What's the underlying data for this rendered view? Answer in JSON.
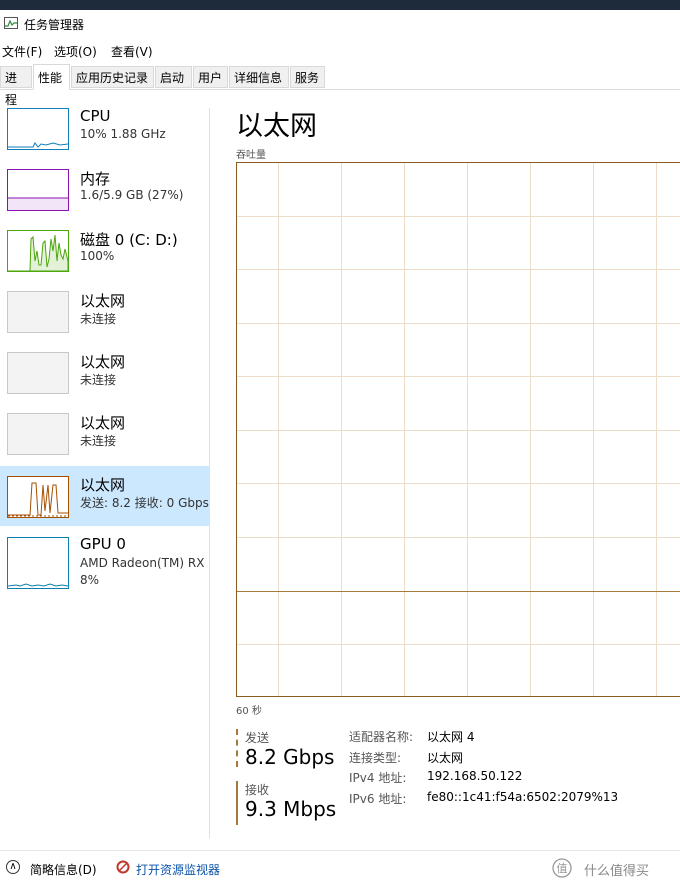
{
  "window": {
    "title": "任务管理器"
  },
  "menu": [
    "文件(F)",
    "选项(O)",
    "查看(V)"
  ],
  "tabs": [
    {
      "label": "进程",
      "active": false
    },
    {
      "label": "性能",
      "active": true
    },
    {
      "label": "应用历史记录",
      "active": false
    },
    {
      "label": "启动",
      "active": false
    },
    {
      "label": "用户",
      "active": false
    },
    {
      "label": "详细信息",
      "active": false
    },
    {
      "label": "服务",
      "active": false
    }
  ],
  "sidebar": [
    {
      "title": "CPU",
      "sub": "10% 1.88 GHz",
      "kind": "cpu"
    },
    {
      "title": "内存",
      "sub": "1.6/5.9 GB (27%)",
      "kind": "memory"
    },
    {
      "title": "磁盘 0 (C: D:)",
      "sub": "100%",
      "kind": "disk"
    },
    {
      "title": "以太网",
      "sub": "未连接",
      "kind": "ethernet-off"
    },
    {
      "title": "以太网",
      "sub": "未连接",
      "kind": "ethernet-off"
    },
    {
      "title": "以太网",
      "sub": "未连接",
      "kind": "ethernet-off"
    },
    {
      "title": "以太网",
      "sub": "发送: 8.2 接收: 0 Gbps",
      "kind": "ethernet-active",
      "selected": true
    },
    {
      "title": "GPU 0",
      "sub": "AMD Radeon(TM) RX",
      "sub2": "8%",
      "kind": "gpu"
    }
  ],
  "main": {
    "title": "以太网",
    "throughput_label": "吞吐量",
    "time_label": "60 秒",
    "send_label": "发送",
    "send_value": "8.2 Gbps",
    "recv_label": "接收",
    "recv_value": "9.3 Mbps",
    "details": [
      {
        "key": "适配器名称:",
        "value": "以太网 4"
      },
      {
        "key": "连接类型:",
        "value": "以太网"
      },
      {
        "key": "IPv4 地址:",
        "value": "192.168.50.122"
      },
      {
        "key": "IPv6 地址:",
        "value": "fe80::1c41:f54a:6502:2079%13"
      }
    ]
  },
  "footer": {
    "fewer_details": "简略信息(D)",
    "open_monitor": "打开资源监视器"
  },
  "watermark": "什么值得买",
  "colors": {
    "cpu": "#117dbb",
    "memory": "#8b12ae",
    "disk": "#4da60c",
    "ethernet": "#a74f01",
    "gpu": "#0c7fb0",
    "selected_bg": "#cce8ff"
  }
}
